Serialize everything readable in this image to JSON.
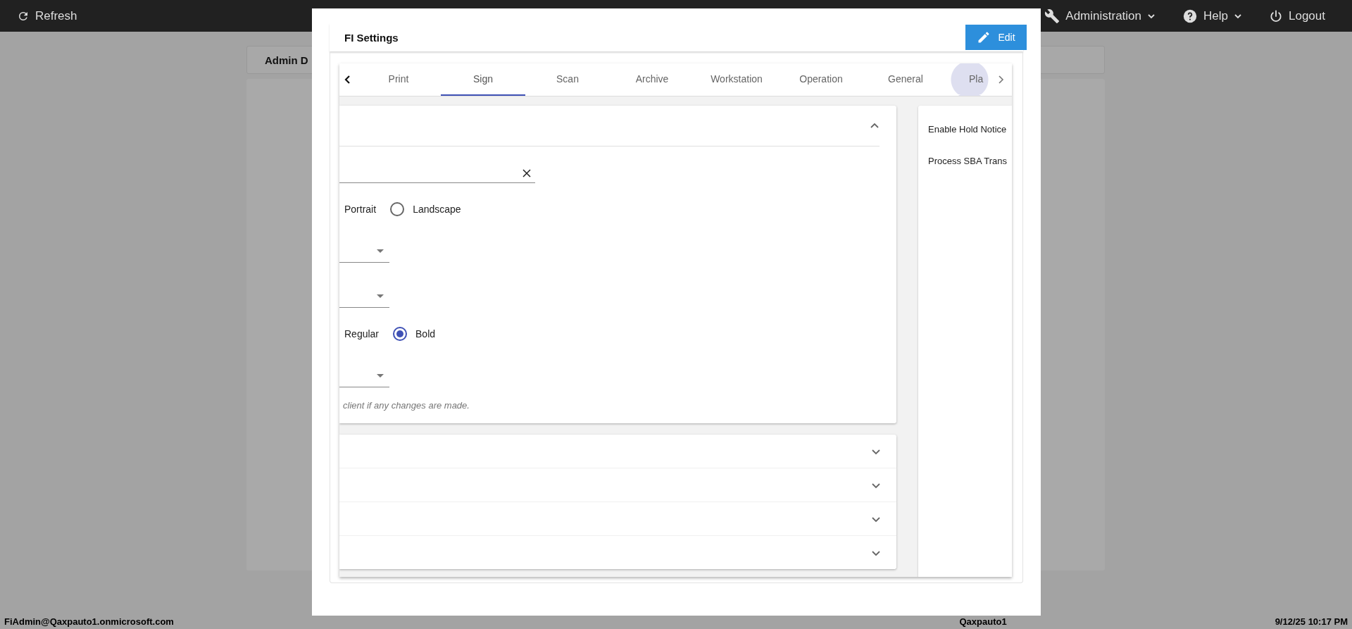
{
  "top_bar": {
    "refresh": "Refresh",
    "menus": [
      {
        "label": "Administration",
        "kind": "admin"
      },
      {
        "label": "Help",
        "kind": "help"
      }
    ],
    "logout": "Logout"
  },
  "background": {
    "card_title": "Admin D"
  },
  "dialog": {
    "title": "FI Settings",
    "edit_button": "Edit",
    "tabs": [
      {
        "label": "Print",
        "selected": false,
        "focused": false
      },
      {
        "label": "Sign",
        "selected": true,
        "focused": false
      },
      {
        "label": "Scan",
        "selected": false,
        "focused": false
      },
      {
        "label": "Archive",
        "selected": false,
        "focused": false
      },
      {
        "label": "Workstation",
        "selected": false,
        "focused": false
      },
      {
        "label": "Operation",
        "selected": false,
        "focused": false
      },
      {
        "label": "General",
        "selected": false,
        "focused": false
      },
      {
        "label": "Pla",
        "selected": false,
        "focused": true
      }
    ],
    "section": {
      "expanded": true,
      "rows": [
        {
          "kind": "text",
          "clearable": true
        },
        {
          "kind": "radio",
          "options": [
            {
              "label": "Portrait"
            },
            {
              "label": "Landscape",
              "selected": false
            }
          ]
        },
        {
          "kind": "select"
        },
        {
          "kind": "select"
        },
        {
          "kind": "radio",
          "options": [
            {
              "label": "Regular"
            },
            {
              "label": "Bold",
              "selected": true
            }
          ]
        },
        {
          "kind": "select"
        },
        {
          "kind": "note",
          "text": "client if any changes are made."
        }
      ]
    },
    "collapsed_sections": [
      {
        "expanded": false
      },
      {
        "expanded": false
      },
      {
        "expanded": false
      },
      {
        "expanded": false
      }
    ],
    "side_panel": {
      "items": [
        "Enable Hold Notice",
        "Process SBA Trans"
      ]
    }
  },
  "status_bar": {
    "user": "FiAdmin@Qaxpauto1.onmicrosoft.com",
    "fi": "Qaxpauto1",
    "datetime": "9/12/25 10:17 PM"
  }
}
